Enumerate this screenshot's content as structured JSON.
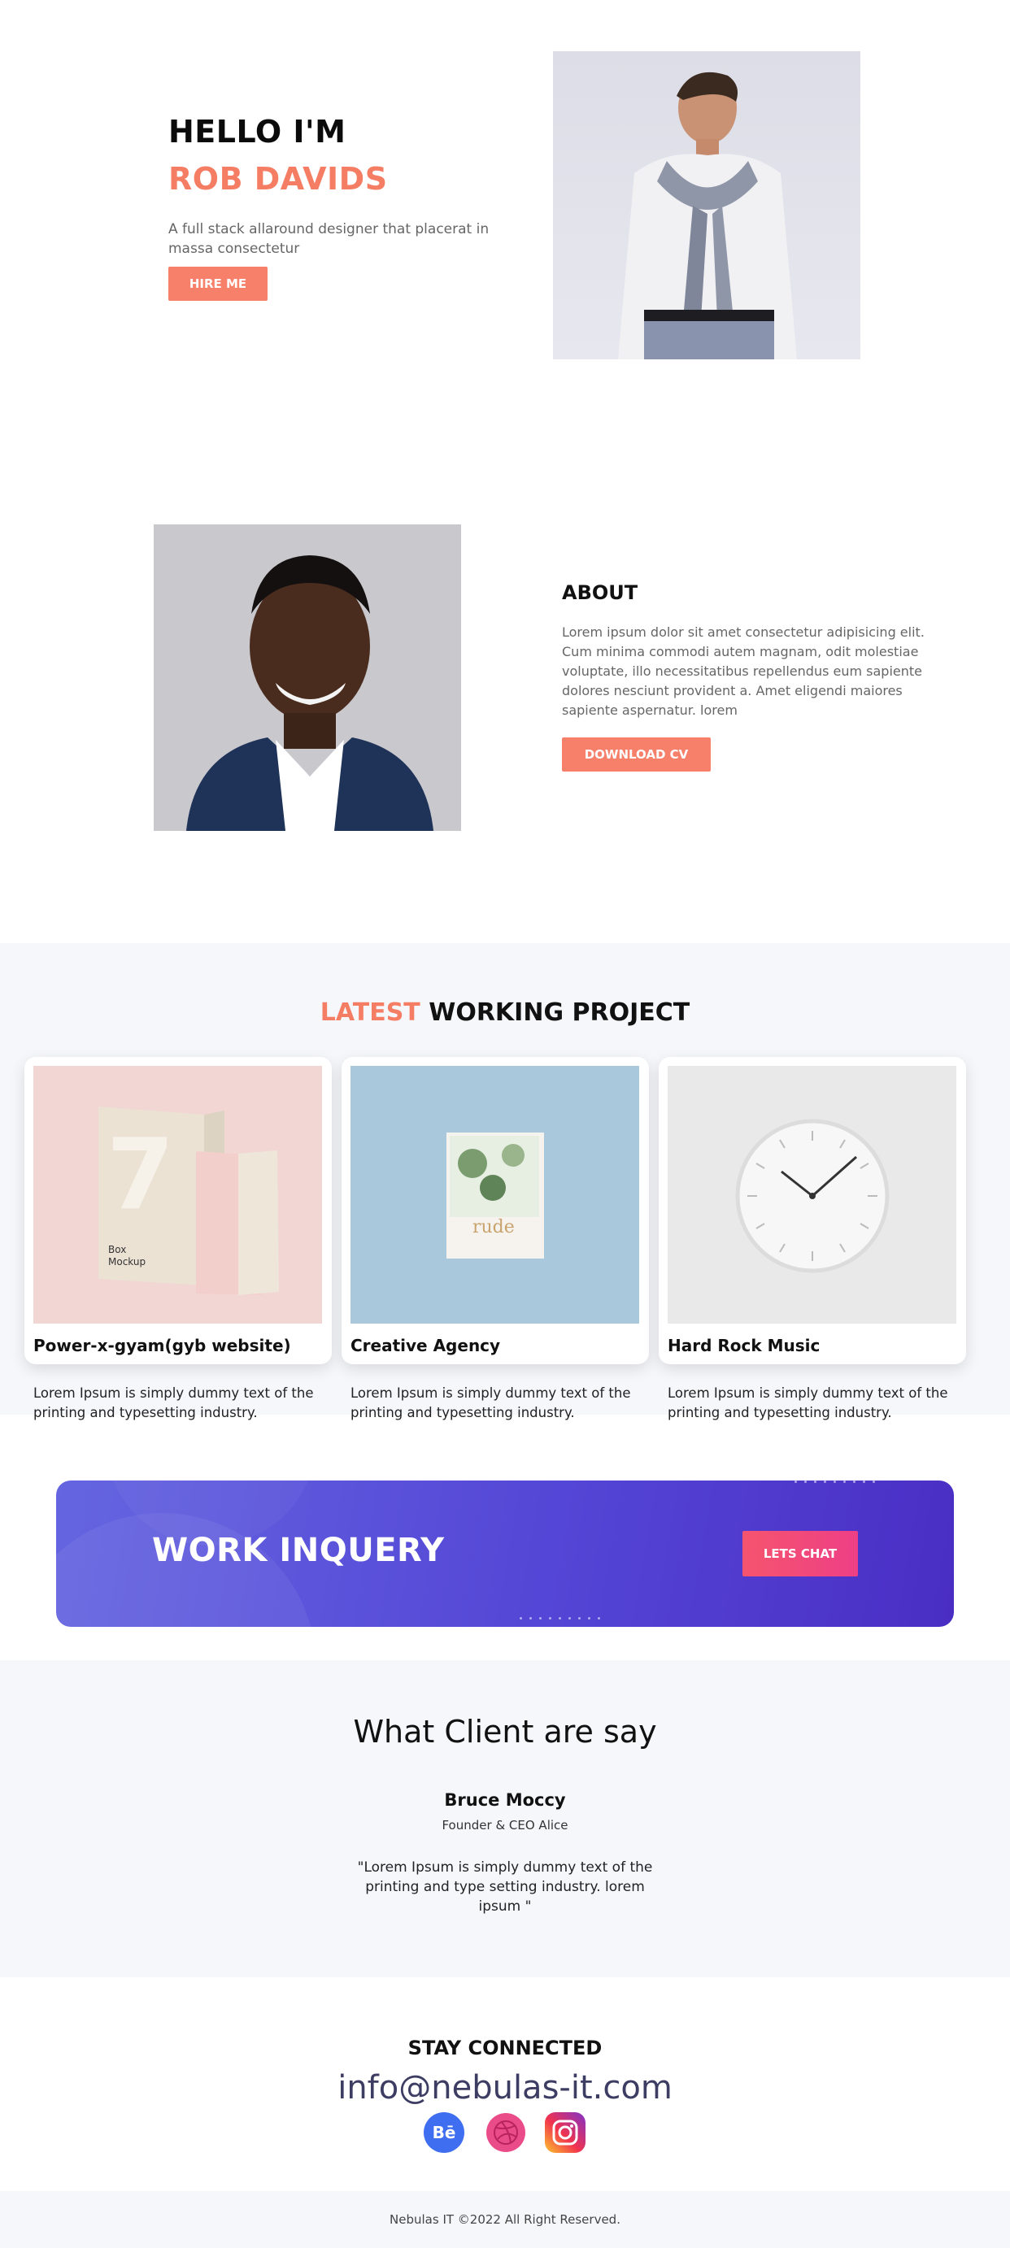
{
  "hero": {
    "greeting": "HELLO I'M",
    "name": "ROB DAVIDS",
    "description": "A full stack allaround designer that placerat in massa consectetur",
    "hire_label": "HIRE ME"
  },
  "about": {
    "title": "ABOUT",
    "text": "Lorem ipsum dolor sit amet consectetur adipisicing elit. Cum minima commodi autem magnam, odit molestiae voluptate, illo necessitatibus repellendus eum sapiente dolores nesciunt provident a. Amet eligendi maiores sapiente aspernatur. lorem",
    "cv_label": "DOWNLOAD CV"
  },
  "projects": {
    "title_highlight": "LATEST",
    "title_rest": "WORKING PROJECT",
    "items": [
      {
        "title": "Power-x-gyam(gyb website)",
        "desc": "Lorem Ipsum is simply dummy text of the printing and typesetting industry.",
        "img_text_a": "Box",
        "img_text_b": "Mockup",
        "img_num": "7"
      },
      {
        "title": "Creative Agency",
        "desc": "Lorem Ipsum is simply dummy text of the printing and typesetting industry.",
        "img_text_a": "rude"
      },
      {
        "title": "Hard Rock Music",
        "desc": "Lorem Ipsum is simply dummy text of the printing and typesetting industry."
      }
    ]
  },
  "inquiry": {
    "title": "WORK INQUERY",
    "chat_label": "LETS CHAT"
  },
  "testimonial": {
    "title": "What Client are say",
    "name": "Bruce Moccy",
    "role": "Founder & CEO Alice",
    "quote": "\"Lorem Ipsum is simply dummy text of the printing and type setting industry. lorem ipsum \""
  },
  "contact": {
    "title": "STAY CONNECTED",
    "email": "info@nebulas-it.com",
    "behance_text": "Bē"
  },
  "footer": {
    "text": "Nebulas IT ©2022 All Right Reserved."
  },
  "colors": {
    "accent": "#f47d63",
    "button": "#f7806a",
    "inquiry_from": "#6565e0",
    "inquiry_to": "#4a2ec4",
    "chat_from": "#f5546e",
    "chat_to": "#ee3f86"
  },
  "icons": [
    "behance-icon",
    "dribbble-icon",
    "instagram-icon"
  ]
}
